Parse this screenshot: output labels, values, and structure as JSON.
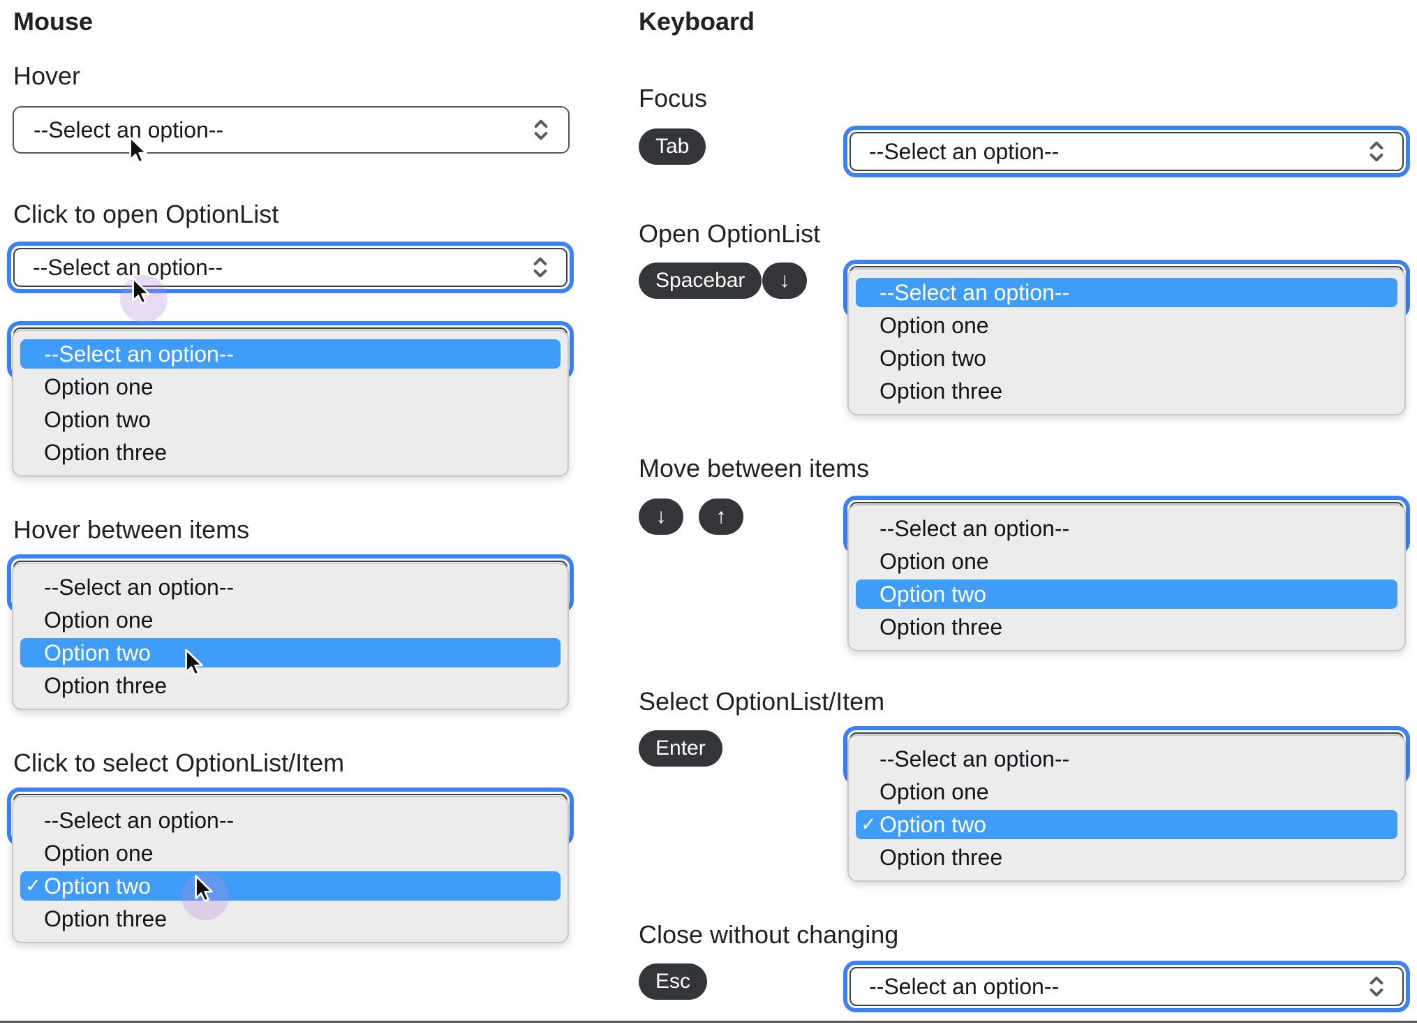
{
  "mouse": {
    "heading": "Mouse",
    "labels": {
      "hover": "Hover",
      "click_open": "Click to open OptionList",
      "hover_items": "Hover between items",
      "click_select": "Click to select OptionList/Item"
    }
  },
  "keyboard": {
    "heading": "Keyboard",
    "labels": {
      "focus": "Focus",
      "open": "Open OptionList",
      "move": "Move between items",
      "select": "Select OptionList/Item",
      "close": "Close without changing"
    }
  },
  "keys": {
    "tab": "Tab",
    "spacebar": "Spacebar",
    "enter": "Enter",
    "esc": "Esc",
    "arrow_down": "↓",
    "arrow_up": "↑"
  },
  "select": {
    "placeholder": "--Select an option--",
    "options": [
      "--Select an option--",
      "Option one",
      "Option two",
      "Option three"
    ],
    "checkmark": "✓"
  },
  "colors": {
    "focus_ring": "#3c82f5",
    "option_highlight": "#3f9df7",
    "key_badge_bg": "#343538",
    "panel_bg": "#ececec",
    "select_border": "#52565e"
  }
}
